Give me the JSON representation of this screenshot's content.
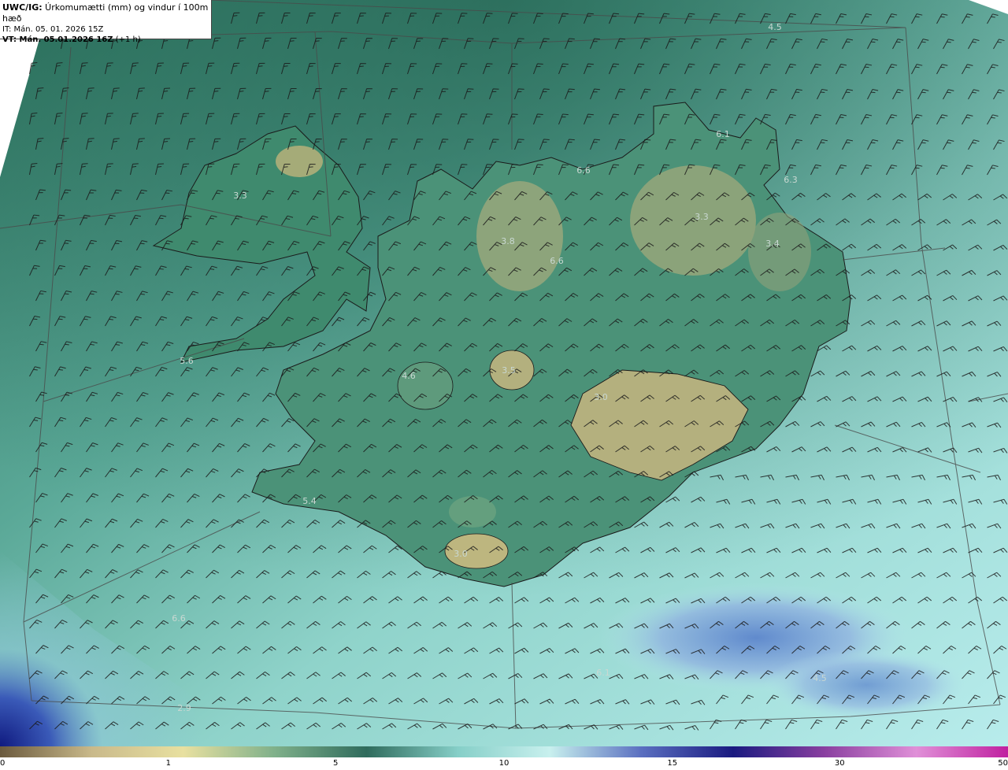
{
  "info": {
    "model": "UWC/IG:",
    "title": " Úrkomumætti (mm) og vindur í 100m hæð",
    "it_line": "IT: Mán. 05. 01. 2026 15Z",
    "vt_bold": "VT: Mán. 05.01.2026 16Z",
    "vt_extra": " (+1 h)"
  },
  "colorbar": {
    "ticks": [
      {
        "label": "0",
        "frac": 0.0
      },
      {
        "label": "1",
        "frac": 0.167
      },
      {
        "label": "5",
        "frac": 0.333
      },
      {
        "label": "10",
        "frac": 0.5
      },
      {
        "label": "15",
        "frac": 0.667
      },
      {
        "label": "30",
        "frac": 0.833
      },
      {
        "label": "50",
        "frac": 1.0
      }
    ],
    "colors": [
      "#6b5a3e",
      "#c9b98a",
      "#e8e0a0",
      "#7fb08a",
      "#2f6b5c",
      "#86cfc8",
      "#c8f0ee",
      "#5a6fc0",
      "#1a1a80",
      "#8a3fa0",
      "#e090d8",
      "#c020a0"
    ]
  },
  "values": [
    {
      "name": "value-label",
      "text": "4.5"
    },
    {
      "name": "value-label",
      "text": "6.1"
    },
    {
      "name": "value-label",
      "text": "6.6"
    },
    {
      "name": "value-label",
      "text": "6.3"
    },
    {
      "name": "value-label",
      "text": "3.3"
    },
    {
      "name": "value-label",
      "text": "3.3"
    },
    {
      "name": "value-label",
      "text": "3.8"
    },
    {
      "name": "value-label",
      "text": "3.4"
    },
    {
      "name": "value-label",
      "text": "6.6"
    },
    {
      "name": "value-label",
      "text": "5.6"
    },
    {
      "name": "value-label",
      "text": "4.6"
    },
    {
      "name": "value-label",
      "text": "3.5"
    },
    {
      "name": "value-label",
      "text": "3.0"
    },
    {
      "name": "value-label",
      "text": "5.4"
    },
    {
      "name": "value-label",
      "text": "3.0"
    },
    {
      "name": "value-label",
      "text": "6.6"
    },
    {
      "name": "value-label",
      "text": "6.1"
    },
    {
      "name": "value-label",
      "text": "4.5"
    },
    {
      "name": "value-label",
      "text": "2.9"
    }
  ]
}
